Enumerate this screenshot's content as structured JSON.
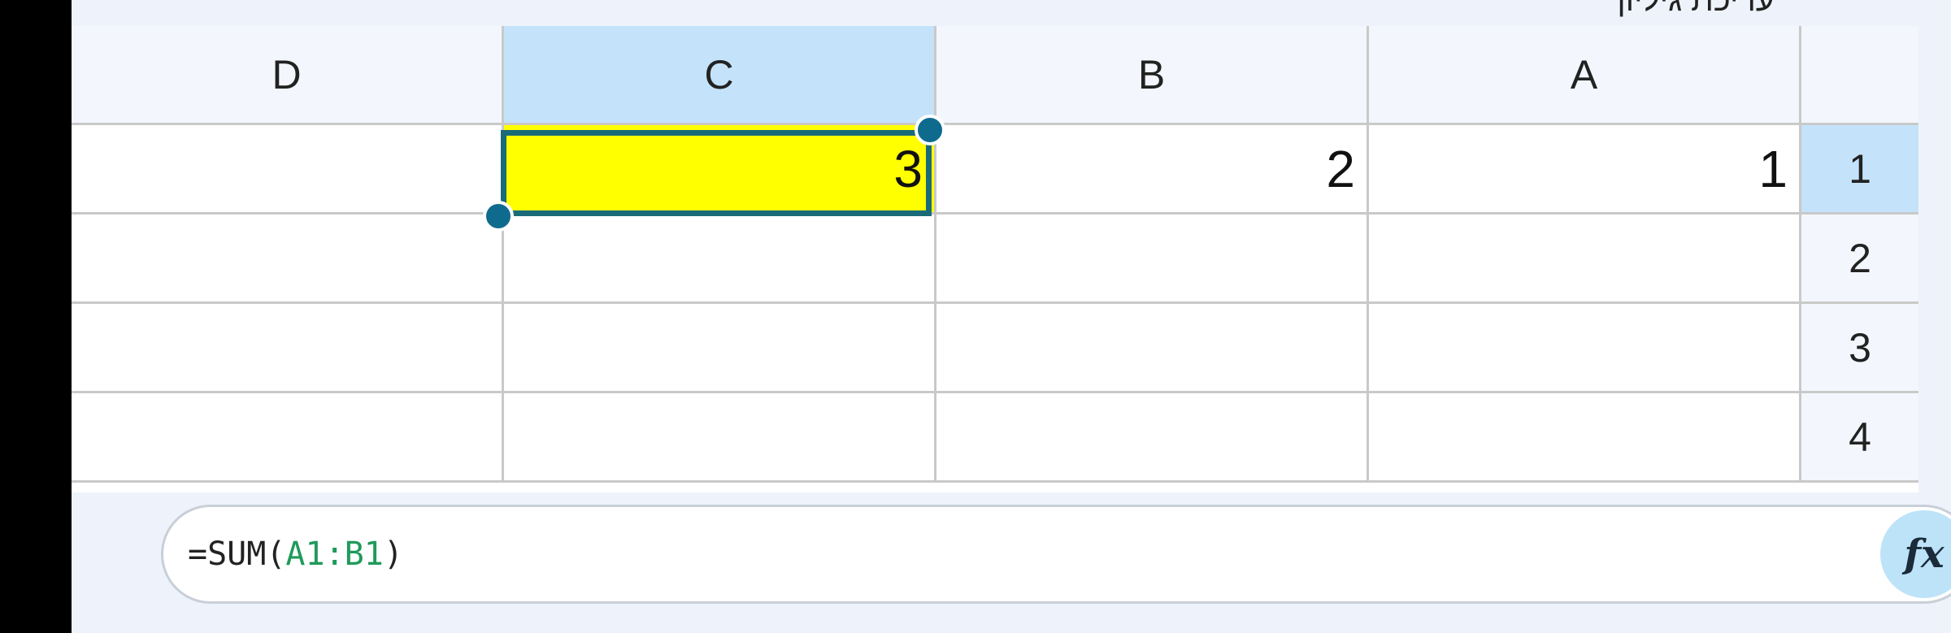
{
  "top_strip": {
    "text": "עריכת גיליון"
  },
  "columns": [
    {
      "label": "D",
      "selected": false
    },
    {
      "label": "C",
      "selected": true
    },
    {
      "label": "B",
      "selected": false
    },
    {
      "label": "A",
      "selected": false
    }
  ],
  "rows": [
    {
      "label": "1",
      "selected": true,
      "cells": {
        "A": "1",
        "B": "2",
        "C": "3",
        "D": ""
      }
    },
    {
      "label": "2",
      "selected": false,
      "cells": {
        "A": "",
        "B": "",
        "C": "",
        "D": ""
      }
    },
    {
      "label": "3",
      "selected": false,
      "cells": {
        "A": "",
        "B": "",
        "C": "",
        "D": ""
      }
    },
    {
      "label": "4",
      "selected": false,
      "cells": {
        "A": "",
        "B": "",
        "C": "",
        "D": ""
      }
    }
  ],
  "selected_cell": "C1",
  "formula_bar": {
    "prefix": "=SUM(",
    "range": "A1:B1",
    "suffix": ")",
    "fx_label": "fx"
  },
  "colors": {
    "selected_header": "#c4e3fb",
    "cell_highlight": "#ffff00",
    "selection_border": "#1a6b78",
    "handle": "#0f6b8e",
    "formula_range": "#1f9a5a"
  }
}
